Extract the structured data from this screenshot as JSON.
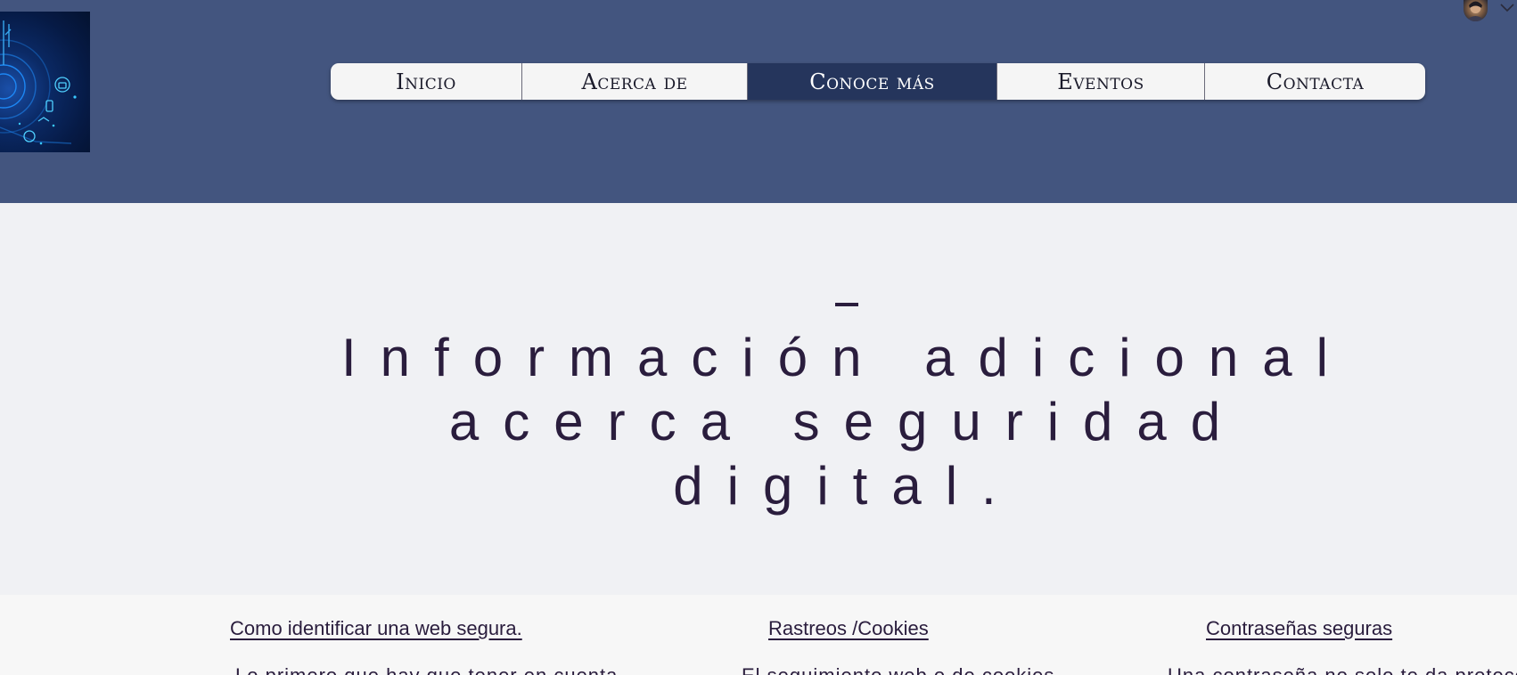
{
  "nav": {
    "items": [
      {
        "label": "Inicio",
        "active": false
      },
      {
        "label": "Acerca de",
        "active": false
      },
      {
        "label": "Conoce más",
        "active": true
      },
      {
        "label": "Eventos",
        "active": false
      },
      {
        "label": "Contacta",
        "active": false
      }
    ]
  },
  "colors": {
    "header_bg": "#43557f",
    "nav_active_bg": "#25355c",
    "title_text": "#2a1d3d",
    "hero_bg": "#f0f1f4"
  },
  "hero": {
    "title": "Información adicional acerca seguridad digital."
  },
  "topics": [
    {
      "title": "Como identificar una web segura.",
      "snippet": "Lo primero que hay que tener en cuenta"
    },
    {
      "title": "Rastreos /Cookies",
      "snippet": "El seguimiento web o de cookies"
    },
    {
      "title": "Contraseñas seguras",
      "snippet": "Una contraseña no solo te da protección"
    }
  ],
  "icons": {
    "logo": "cybersecurity-key-logo",
    "avatar": "user-avatar",
    "account_menu": "chevron-down-icon"
  }
}
